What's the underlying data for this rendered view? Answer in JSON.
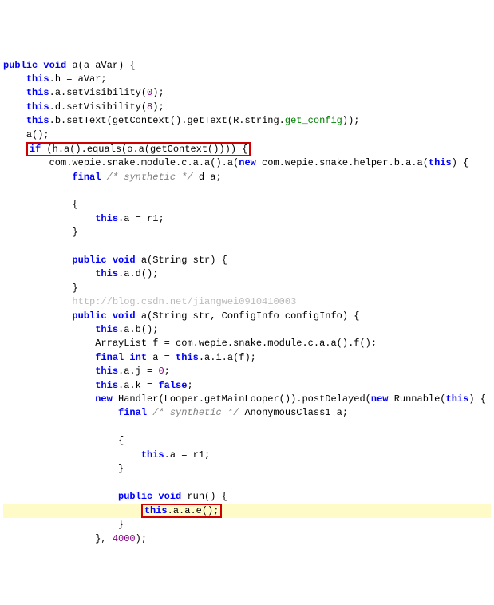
{
  "code": {
    "l1": {
      "kw1": "public void",
      "fn": " a(a aVar) {"
    },
    "l2": {
      "kw1": "this",
      "rest": ".h = aVar;"
    },
    "l3": {
      "kw1": "this",
      "mid": ".a.setVisibility(",
      "num": "0",
      "end": ");"
    },
    "l4": {
      "kw1": "this",
      "mid": ".d.setVisibility(",
      "num": "8",
      "end": ");"
    },
    "l5": {
      "kw1": "this",
      "mid": ".b.setText(getContext().getText(R.string.",
      "str": "get_config",
      "end": "));"
    },
    "l6": {
      "txt": "a();"
    },
    "l7": {
      "kw1": "if",
      "txt": " (h.a().equals(o.a(getContext()))) {"
    },
    "l8": {
      "p1": "com.wepie.snake.module.c.a.a().a(",
      "kw1": "new",
      "p2": " com.wepie.snake.helper.b.a.a(",
      "kw2": "this",
      "p3": ") {"
    },
    "l9": {
      "kw1": "final",
      "cmt": " /* synthetic */",
      "p1": " d a;"
    },
    "l10": {
      "txt": "{"
    },
    "l11": {
      "kw1": "this",
      "txt": ".a = r1;"
    },
    "l12": {
      "txt": "}"
    },
    "l13": {
      "kw1": "public void",
      "p1": " a(String str) {"
    },
    "l14": {
      "kw1": "this",
      "txt": ".a.d();"
    },
    "l15": {
      "txt": "}"
    },
    "wm": "http://blog.csdn.net/jiangwei0910410003",
    "l16": {
      "kw1": "public void",
      "p1": " a(String str, ConfigInfo configInfo) {"
    },
    "l17": {
      "kw1": "this",
      "txt": ".a.b();"
    },
    "l18": {
      "p1": "ArrayList f = com.wepie.snake.module.c.a.a().f();"
    },
    "l19": {
      "kw1": "final int",
      "p1": " a = ",
      "kw2": "this",
      "p2": ".a.i.a(f);"
    },
    "l20": {
      "kw1": "this",
      "p1": ".a.j = ",
      "num": "0",
      "end": ";"
    },
    "l21": {
      "kw1": "this",
      "p1": ".a.k = ",
      "kw2": "false",
      "end": ";"
    },
    "l22": {
      "kw1": "new",
      "p1": " Handler(Looper.getMainLooper()).postDelayed(",
      "kw2": "new",
      "p2": " Runnable(",
      "kw3": "this",
      "p3": ") {"
    },
    "l23": {
      "kw1": "final",
      "cmt": " /* synthetic */",
      "p1": " AnonymousClass1 a;"
    },
    "l24": {
      "txt": "{"
    },
    "l25": {
      "kw1": "this",
      "txt": ".a = r1;"
    },
    "l26": {
      "txt": "}"
    },
    "l27": {
      "kw1": "public void",
      "p1": " run() {"
    },
    "l28": {
      "kw1": "this",
      "txt": ".a.a.e();"
    },
    "l29": {
      "txt": "}"
    },
    "l30": {
      "p1": "}, ",
      "num": "4000",
      "end": ");"
    }
  }
}
